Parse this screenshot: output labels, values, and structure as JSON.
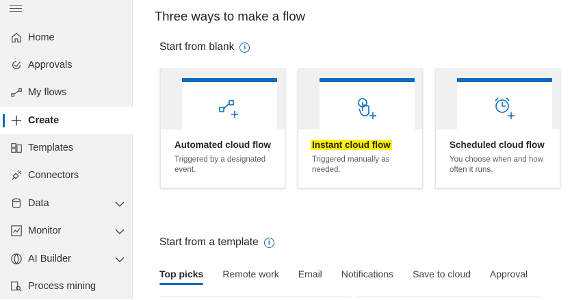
{
  "sidebar": {
    "items": [
      {
        "label": "Home",
        "icon": "home-icon"
      },
      {
        "label": "Approvals",
        "icon": "approvals-icon"
      },
      {
        "label": "My flows",
        "icon": "flows-icon"
      },
      {
        "label": "Create",
        "icon": "plus-icon",
        "active": true
      },
      {
        "label": "Templates",
        "icon": "templates-icon"
      },
      {
        "label": "Connectors",
        "icon": "connectors-icon"
      },
      {
        "label": "Data",
        "icon": "data-icon",
        "expandable": true
      },
      {
        "label": "Monitor",
        "icon": "monitor-icon",
        "expandable": true
      },
      {
        "label": "AI Builder",
        "icon": "ai-builder-icon",
        "expandable": true
      },
      {
        "label": "Process mining",
        "icon": "process-mining-icon"
      }
    ]
  },
  "main": {
    "title": "Three ways to make a flow",
    "blank_section": "Start from blank",
    "template_section": "Start from a template",
    "cards": [
      {
        "title": "Automated cloud flow",
        "desc": "Triggered by a designated event.",
        "icon": "automated-flow-icon"
      },
      {
        "title": "Instant cloud flow",
        "desc": "Triggered manually as needed.",
        "icon": "instant-flow-icon",
        "highlighted": true
      },
      {
        "title": "Scheduled cloud flow",
        "desc": "You choose when and how often it runs.",
        "icon": "scheduled-flow-icon"
      }
    ],
    "tabs": [
      "Top picks",
      "Remote work",
      "Email",
      "Notifications",
      "Save to cloud",
      "Approval"
    ]
  },
  "colors": {
    "accent": "#0f6cbd",
    "highlight": "#fff200"
  }
}
